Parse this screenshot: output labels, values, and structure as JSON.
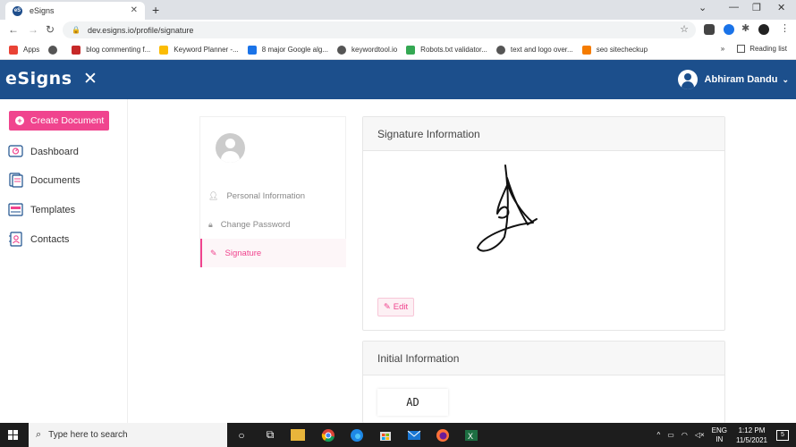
{
  "browser": {
    "tab_title": "eSigns",
    "tab_favicon_text": "eS",
    "url": "dev.esigns.io/profile/signature",
    "bookmarks": [
      {
        "label": "Apps",
        "color": "#e94235"
      },
      {
        "label": "",
        "color": "#555555"
      },
      {
        "label": "blog commenting f...",
        "color": "#c62828"
      },
      {
        "label": "Keyword Planner -...",
        "color": "#fbbc04"
      },
      {
        "label": "8 major Google alg...",
        "color": "#1a73e8"
      },
      {
        "label": "keywordtool.io",
        "color": "#555555"
      },
      {
        "label": "Robots.txt validator...",
        "color": "#34a853"
      },
      {
        "label": "text and logo over...",
        "color": "#555555"
      },
      {
        "label": "seo sitecheckup",
        "color": "#f57c00"
      }
    ],
    "reading_list": "Reading list",
    "more_bookmarks": "»"
  },
  "header": {
    "logo": "eSigns",
    "user_name": "Abhiram Dandu"
  },
  "sidebar": {
    "create_label": "Create Document",
    "items": [
      {
        "label": "Dashboard",
        "icon": "dashboard-icon"
      },
      {
        "label": "Documents",
        "icon": "documents-icon"
      },
      {
        "label": "Templates",
        "icon": "templates-icon"
      },
      {
        "label": "Contacts",
        "icon": "contacts-icon"
      }
    ]
  },
  "profile_menu": {
    "items": [
      {
        "label": "Personal Information",
        "icon": "user-icon"
      },
      {
        "label": "Change Password",
        "icon": "lock-icon"
      },
      {
        "label": "Signature",
        "icon": "pen-icon",
        "active": true
      }
    ]
  },
  "signature_card": {
    "title": "Signature Information",
    "edit_label": "Edit"
  },
  "initial_card": {
    "title": "Initial Information",
    "initials": "AD"
  },
  "taskbar": {
    "search_placeholder": "Type here to search",
    "lang_line1": "ENG",
    "lang_line2": "IN",
    "time": "1:12 PM",
    "date": "11/5/2021",
    "notification_count": "5"
  },
  "colors": {
    "brand": "#1c4f8c",
    "accent": "#f0448e"
  }
}
